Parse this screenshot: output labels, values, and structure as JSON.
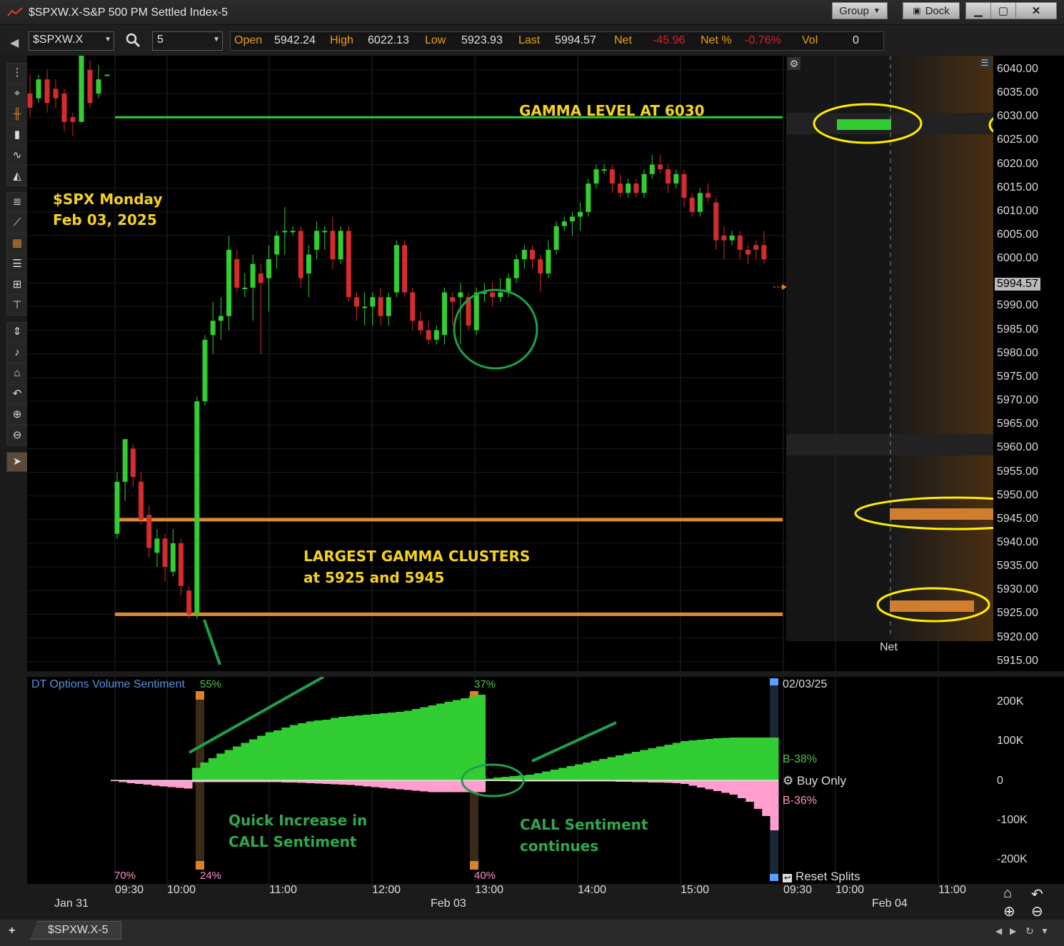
{
  "window": {
    "title": "$SPXW.X-S&P 500 PM Settled Index-5",
    "group_label": "Group",
    "dock_label": "Dock"
  },
  "toolbar": {
    "symbol": "$SPXW.X",
    "interval": "5",
    "quote": {
      "open_label": "Open",
      "open": "5942.24",
      "high_label": "High",
      "high": "6022.13",
      "low_label": "Low",
      "low": "5923.93",
      "last_label": "Last",
      "last": "5994.57",
      "net_label": "Net",
      "net": "-45.96",
      "netpct_label": "Net %",
      "netpct": "-0.76%",
      "vol_label": "Vol",
      "vol": "0"
    }
  },
  "price_axis": {
    "ticks": [
      "6040.00",
      "6035.00",
      "6030.00",
      "6025.00",
      "6020.00",
      "6015.00",
      "6010.00",
      "6005.00",
      "6000.00",
      "5994.57",
      "5990.00",
      "5985.00",
      "5980.00",
      "5975.00",
      "5970.00",
      "5965.00",
      "5960.00",
      "5955.00",
      "5950.00",
      "5945.00",
      "5940.00",
      "5935.00",
      "5930.00",
      "5925.00",
      "5920.00",
      "5915.00"
    ],
    "last_price": "5994.57"
  },
  "annotations": {
    "gamma_level": "GAMMA LEVEL AT 6030",
    "spx_line1": "$SPX Monday",
    "spx_line2": "Feb 03, 2025",
    "clusters_line1": "LARGEST GAMMA CLUSTERS",
    "clusters_line2": "at 5925 and 5945",
    "quick_line1": "Quick Increase in",
    "quick_line2": "CALL Sentiment",
    "cont_line1": "CALL Sentiment",
    "cont_line2": "continues"
  },
  "profile": {
    "net_label": "Net"
  },
  "lower_panel": {
    "title": "DT Options Volume Sentiment",
    "pct_55": "55%",
    "pct_37": "37%",
    "pct_70": "70%",
    "pct_24": "24%",
    "pct_40": "40%",
    "date": "02/03/25",
    "b_call": "B-38%",
    "b_put": "B-36%",
    "buy_only": "Buy Only",
    "reset_splits": "Reset Splits",
    "y_ticks": [
      "200K",
      "100K",
      "0",
      "-100K",
      "-200K"
    ]
  },
  "time_axis": {
    "times": [
      "09:30",
      "10:00",
      "11:00",
      "12:00",
      "13:00",
      "14:00",
      "15:00",
      "09:30",
      "10:00",
      "11:00"
    ],
    "dates": [
      "Jan 31",
      "Feb 03",
      "Feb 04"
    ]
  },
  "status": {
    "tab": "$SPXW.X-5"
  },
  "chart_data": {
    "type": "candlestick",
    "title": "$SPXW.X-S&P 500 PM Settled Index-5",
    "ylim": [
      5913,
      6043
    ],
    "levels": [
      {
        "name": "gamma",
        "value": 6030,
        "color": "#32cd32"
      },
      {
        "name": "cluster",
        "value": 5945,
        "color": "#d88a3a"
      },
      {
        "name": "cluster",
        "value": 5925,
        "color": "#d88a3a"
      }
    ],
    "prior_day": [
      {
        "o": 6035,
        "c": 6032,
        "h": 6039,
        "l": 6030
      },
      {
        "o": 6034,
        "c": 6038,
        "h": 6039,
        "l": 6033
      },
      {
        "o": 6038,
        "c": 6033,
        "h": 6040,
        "l": 6031
      },
      {
        "o": 6036,
        "c": 6034,
        "h": 6038,
        "l": 6032
      },
      {
        "o": 6035,
        "c": 6029,
        "h": 6036,
        "l": 6027
      },
      {
        "o": 6030,
        "c": 6029,
        "h": 6031,
        "l": 6026
      },
      {
        "o": 6029,
        "c": 6043,
        "h": 6043,
        "l": 6029
      },
      {
        "o": 6040,
        "c": 6033,
        "h": 6042,
        "l": 6032
      },
      {
        "o": 6035,
        "c": 6038,
        "h": 6041,
        "l": 6034
      },
      {
        "o": 6039,
        "c": 6039,
        "h": 6039,
        "l": 6039
      }
    ],
    "candles": [
      {
        "o": 5942,
        "c": 5953,
        "h": 5955,
        "l": 5941
      },
      {
        "o": 5953,
        "c": 5962,
        "h": 5962,
        "l": 5949
      },
      {
        "o": 5960,
        "c": 5954,
        "h": 5961,
        "l": 5952
      },
      {
        "o": 5953,
        "c": 5945,
        "h": 5955,
        "l": 5944
      },
      {
        "o": 5946,
        "c": 5939,
        "h": 5948,
        "l": 5937
      },
      {
        "o": 5938,
        "c": 5941,
        "h": 5943,
        "l": 5935
      },
      {
        "o": 5941,
        "c": 5935,
        "h": 5942,
        "l": 5932
      },
      {
        "o": 5934,
        "c": 5940,
        "h": 5943,
        "l": 5933
      },
      {
        "o": 5940,
        "c": 5931,
        "h": 5941,
        "l": 5929
      },
      {
        "o": 5930,
        "c": 5925,
        "h": 5931,
        "l": 5924
      },
      {
        "o": 5925,
        "c": 5970,
        "h": 5971,
        "l": 5924
      },
      {
        "o": 5970,
        "c": 5983,
        "h": 5984,
        "l": 5969
      },
      {
        "o": 5984,
        "c": 5987,
        "h": 5991,
        "l": 5980
      },
      {
        "o": 5987,
        "c": 5988,
        "h": 5992,
        "l": 5983
      },
      {
        "o": 5988,
        "c": 6002,
        "h": 6005,
        "l": 5985
      },
      {
        "o": 6000,
        "c": 5994,
        "h": 6002,
        "l": 5993
      },
      {
        "o": 5994,
        "c": 5994,
        "h": 5997,
        "l": 5992
      },
      {
        "o": 5994,
        "c": 5999,
        "h": 6001,
        "l": 5987
      },
      {
        "o": 5997,
        "c": 5995,
        "h": 5999,
        "l": 5980
      },
      {
        "o": 5996,
        "c": 6000,
        "h": 6003,
        "l": 5989
      },
      {
        "o": 6001,
        "c": 6005,
        "h": 6006,
        "l": 5998
      },
      {
        "o": 6006,
        "c": 6006,
        "h": 6011,
        "l": 6001
      },
      {
        "o": 6006,
        "c": 6006,
        "h": 6007,
        "l": 6005
      },
      {
        "o": 6006,
        "c": 5996,
        "h": 6007,
        "l": 5994
      },
      {
        "o": 5997,
        "c": 6001,
        "h": 6003,
        "l": 5992
      },
      {
        "o": 6002,
        "c": 6006,
        "h": 6008,
        "l": 6000
      },
      {
        "o": 6006,
        "c": 6006,
        "h": 6007,
        "l": 6002
      },
      {
        "o": 6006,
        "c": 6000,
        "h": 6009,
        "l": 5998
      },
      {
        "o": 6000,
        "c": 6006,
        "h": 6007,
        "l": 5999
      },
      {
        "o": 6006,
        "c": 5992,
        "h": 6007,
        "l": 5991
      },
      {
        "o": 5992,
        "c": 5990,
        "h": 5993,
        "l": 5987
      },
      {
        "o": 5990,
        "c": 5990,
        "h": 5993,
        "l": 5986
      },
      {
        "o": 5990,
        "c": 5992,
        "h": 5993,
        "l": 5986
      },
      {
        "o": 5992,
        "c": 5988,
        "h": 5994,
        "l": 5986
      },
      {
        "o": 5988,
        "c": 5992,
        "h": 5993,
        "l": 5986
      },
      {
        "o": 5993,
        "c": 6003,
        "h": 6004,
        "l": 5992
      },
      {
        "o": 6003,
        "c": 5993,
        "h": 6004,
        "l": 5992
      },
      {
        "o": 5993,
        "c": 5987,
        "h": 5994,
        "l": 5985
      },
      {
        "o": 5987,
        "c": 5985,
        "h": 5989,
        "l": 5984
      },
      {
        "o": 5985,
        "c": 5983,
        "h": 5987,
        "l": 5982
      },
      {
        "o": 5983,
        "c": 5985,
        "h": 5986,
        "l": 5982
      },
      {
        "o": 5984,
        "c": 5993,
        "h": 5994,
        "l": 5982
      },
      {
        "o": 5992,
        "c": 5991,
        "h": 5993,
        "l": 5986
      },
      {
        "o": 5992,
        "c": 5993,
        "h": 5995,
        "l": 5982
      },
      {
        "o": 5992,
        "c": 5986,
        "h": 5993,
        "l": 5985
      },
      {
        "o": 5985,
        "c": 5993,
        "h": 5994,
        "l": 5984
      },
      {
        "o": 5993,
        "c": 5993,
        "h": 5995,
        "l": 5991
      },
      {
        "o": 5993,
        "c": 5992,
        "h": 5995,
        "l": 5990
      },
      {
        "o": 5992,
        "c": 5993,
        "h": 5996,
        "l": 5991
      },
      {
        "o": 5993,
        "c": 5996,
        "h": 5997,
        "l": 5992
      },
      {
        "o": 5996,
        "c": 6000,
        "h": 6001,
        "l": 5995
      },
      {
        "o": 6000,
        "c": 6002,
        "h": 6003,
        "l": 5998
      },
      {
        "o": 6002,
        "c": 6000,
        "h": 6003,
        "l": 5998
      },
      {
        "o": 6000,
        "c": 5997,
        "h": 6001,
        "l": 5993
      },
      {
        "o": 5997,
        "c": 6002,
        "h": 6004,
        "l": 5996
      },
      {
        "o": 6002,
        "c": 6007,
        "h": 6008,
        "l": 6001
      },
      {
        "o": 6007,
        "c": 6008,
        "h": 6009,
        "l": 6006
      },
      {
        "o": 6008,
        "c": 6009,
        "h": 6010,
        "l": 6005
      },
      {
        "o": 6009,
        "c": 6010,
        "h": 6012,
        "l": 6006
      },
      {
        "o": 6010,
        "c": 6016,
        "h": 6017,
        "l": 6009
      },
      {
        "o": 6016,
        "c": 6019,
        "h": 6020,
        "l": 6015
      },
      {
        "o": 6019,
        "c": 6019,
        "h": 6020,
        "l": 6018
      },
      {
        "o": 6019,
        "c": 6016,
        "h": 6020,
        "l": 6014
      },
      {
        "o": 6016,
        "c": 6014,
        "h": 6018,
        "l": 6013
      },
      {
        "o": 6014,
        "c": 6016,
        "h": 6017,
        "l": 6013
      },
      {
        "o": 6016,
        "c": 6014,
        "h": 6017,
        "l": 6013
      },
      {
        "o": 6014,
        "c": 6018,
        "h": 6019,
        "l": 6013
      },
      {
        "o": 6018,
        "c": 6020,
        "h": 6022,
        "l": 6017
      },
      {
        "o": 6020,
        "c": 6019,
        "h": 6022,
        "l": 6018
      },
      {
        "o": 6019,
        "c": 6016,
        "h": 6020,
        "l": 6014
      },
      {
        "o": 6016,
        "c": 6018,
        "h": 6019,
        "l": 6015
      },
      {
        "o": 6018,
        "c": 6013,
        "h": 6019,
        "l": 6011
      },
      {
        "o": 6013,
        "c": 6010,
        "h": 6014,
        "l": 6009
      },
      {
        "o": 6010,
        "c": 6014,
        "h": 6015,
        "l": 6009
      },
      {
        "o": 6014,
        "c": 6013,
        "h": 6016,
        "l": 6012
      },
      {
        "o": 6012,
        "c": 6004,
        "h": 6013,
        "l": 6002
      },
      {
        "o": 6005,
        "c": 6004,
        "h": 6007,
        "l": 6000
      },
      {
        "o": 6004,
        "c": 6005,
        "h": 6006,
        "l": 6003
      },
      {
        "o": 6005,
        "c": 6002,
        "h": 6006,
        "l": 6000
      },
      {
        "o": 6002,
        "c": 6001,
        "h": 6003,
        "l": 5999
      },
      {
        "o": 6003,
        "c": 6002,
        "h": 6004,
        "l": 6000
      },
      {
        "o": 6003,
        "c": 6000,
        "h": 6006,
        "l": 5999
      }
    ],
    "sentiment": {
      "ylim": [
        -250000,
        250000
      ],
      "call_cumulative": [
        0,
        0,
        0,
        0,
        0,
        0,
        0,
        0,
        0,
        0,
        35000,
        50000,
        62000,
        75000,
        85000,
        95000,
        105000,
        115000,
        125000,
        135000,
        140000,
        148000,
        155000,
        160000,
        165000,
        168000,
        170000,
        175000,
        178000,
        180000,
        182000,
        184000,
        186000,
        188000,
        190000,
        192000,
        195000,
        200000,
        205000,
        210000,
        215000,
        220000,
        225000,
        230000,
        235000,
        240000,
        5000,
        8000,
        10000,
        12000,
        14000,
        16000,
        20000,
        25000,
        30000,
        35000,
        40000,
        45000,
        50000,
        55000,
        60000,
        65000,
        70000,
        75000,
        80000,
        85000,
        90000,
        95000,
        100000,
        105000,
        110000,
        112000,
        114000,
        116000,
        118000,
        119000,
        120000,
        120000,
        120000,
        120000,
        120000,
        120000
      ],
      "put_cumulative": [
        -2000,
        -5000,
        -8000,
        -10000,
        -12000,
        -15000,
        -17000,
        -19000,
        -21000,
        -23000,
        -5000,
        -5000,
        -5000,
        -5000,
        -5000,
        -5000,
        -5000,
        -5000,
        -5000,
        -5000,
        -5000,
        -6000,
        -6000,
        -7000,
        -8000,
        -9000,
        -10000,
        -11000,
        -12000,
        -13000,
        -15000,
        -17000,
        -19000,
        -21000,
        -23000,
        -25000,
        -27000,
        -29000,
        -31000,
        -33000,
        -33000,
        -33000,
        -33000,
        -33000,
        -33000,
        -33000,
        -2000,
        -2000,
        -2000,
        -3000,
        -3000,
        -3000,
        -3000,
        -3000,
        -3000,
        -3000,
        -3000,
        -3000,
        -3000,
        -3000,
        -3000,
        -3000,
        -4000,
        -4000,
        -5000,
        -5000,
        -6000,
        -6000,
        -7000,
        -8000,
        -10000,
        -15000,
        -20000,
        -25000,
        -30000,
        -35000,
        -40000,
        -50000,
        -60000,
        -80000,
        -100000,
        -140000
      ]
    }
  }
}
